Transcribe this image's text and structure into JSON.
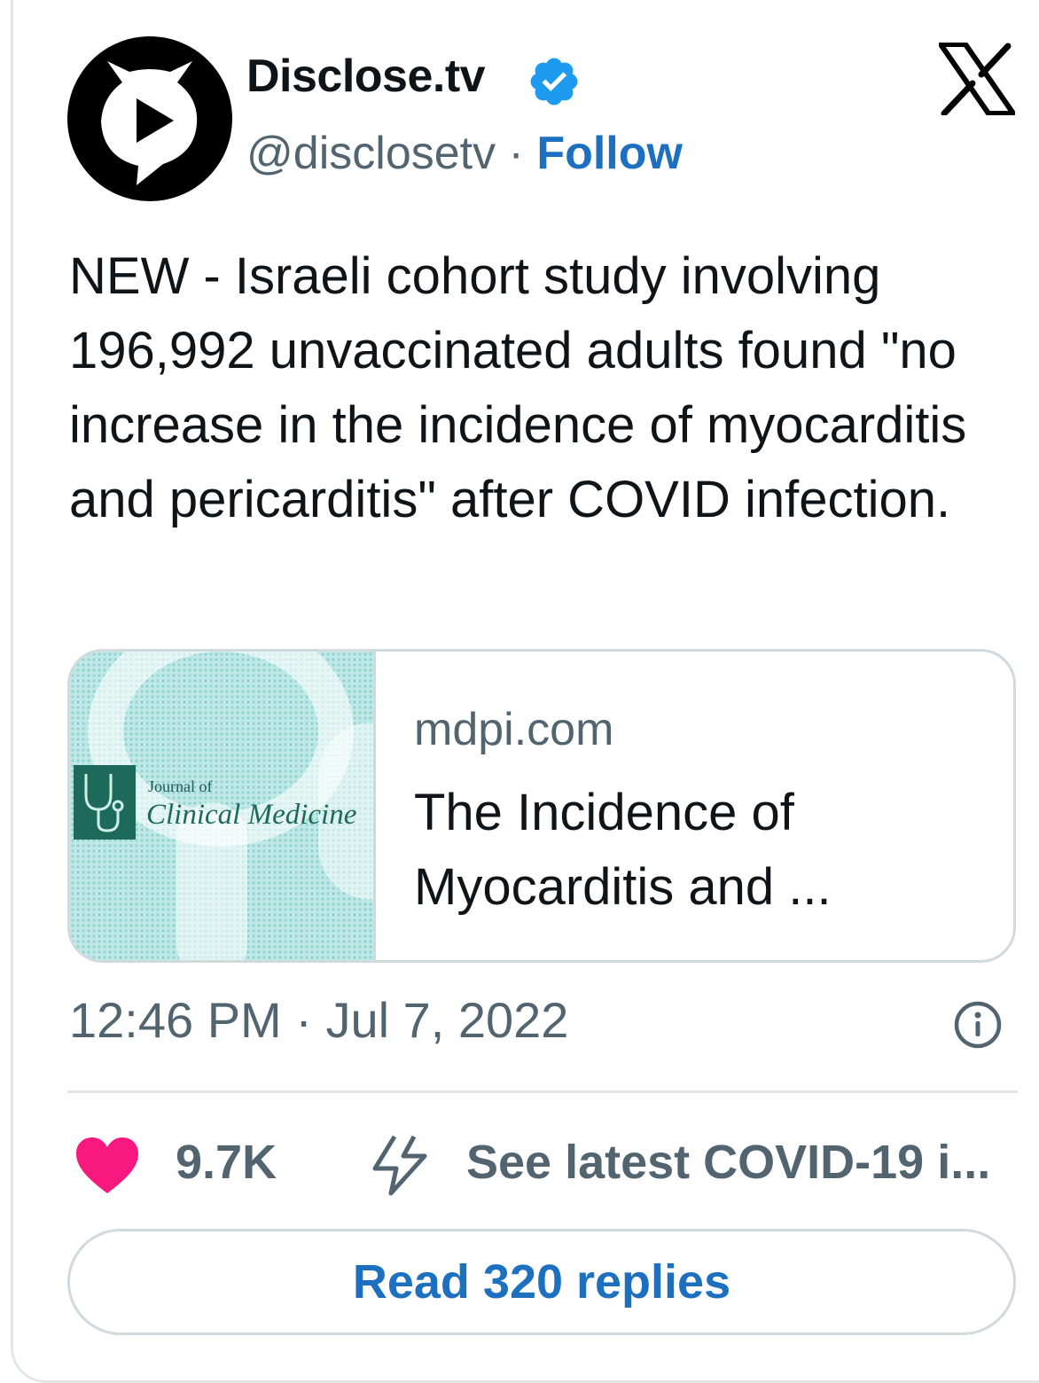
{
  "author": {
    "display_name": "Disclose.tv",
    "handle": "@disclosetv",
    "separator": " · ",
    "follow_label": "Follow",
    "verified": true
  },
  "tweet": {
    "text": "NEW - Israeli cohort study involving 196,992 unvaccinated adults found \"no increase in the incidence of myocarditis and pericarditis\" after COVID infection.",
    "timestamp": "12:46 PM · Jul 7, 2022"
  },
  "link_card": {
    "thumbnail_small": "Journal of",
    "thumbnail_big": "Clinical Medicine",
    "domain": "mdpi.com",
    "title": "The Incidence of Myocarditis and ..."
  },
  "actions": {
    "likes": "9.7K",
    "covid_label": "See latest COVID-19 i...",
    "replies_button": "Read 320 replies"
  },
  "colors": {
    "link_blue": "#1d6fbf",
    "heart_pink": "#f91880",
    "muted_gray": "#536471",
    "verified_blue": "#1d9bf0"
  },
  "icons": {
    "avatar": "disclose-tv-logo-icon",
    "verified": "verified-badge-icon",
    "platform": "x-logo-icon",
    "info": "info-icon",
    "like": "heart-icon",
    "covid": "lightning-bolt-icon"
  }
}
